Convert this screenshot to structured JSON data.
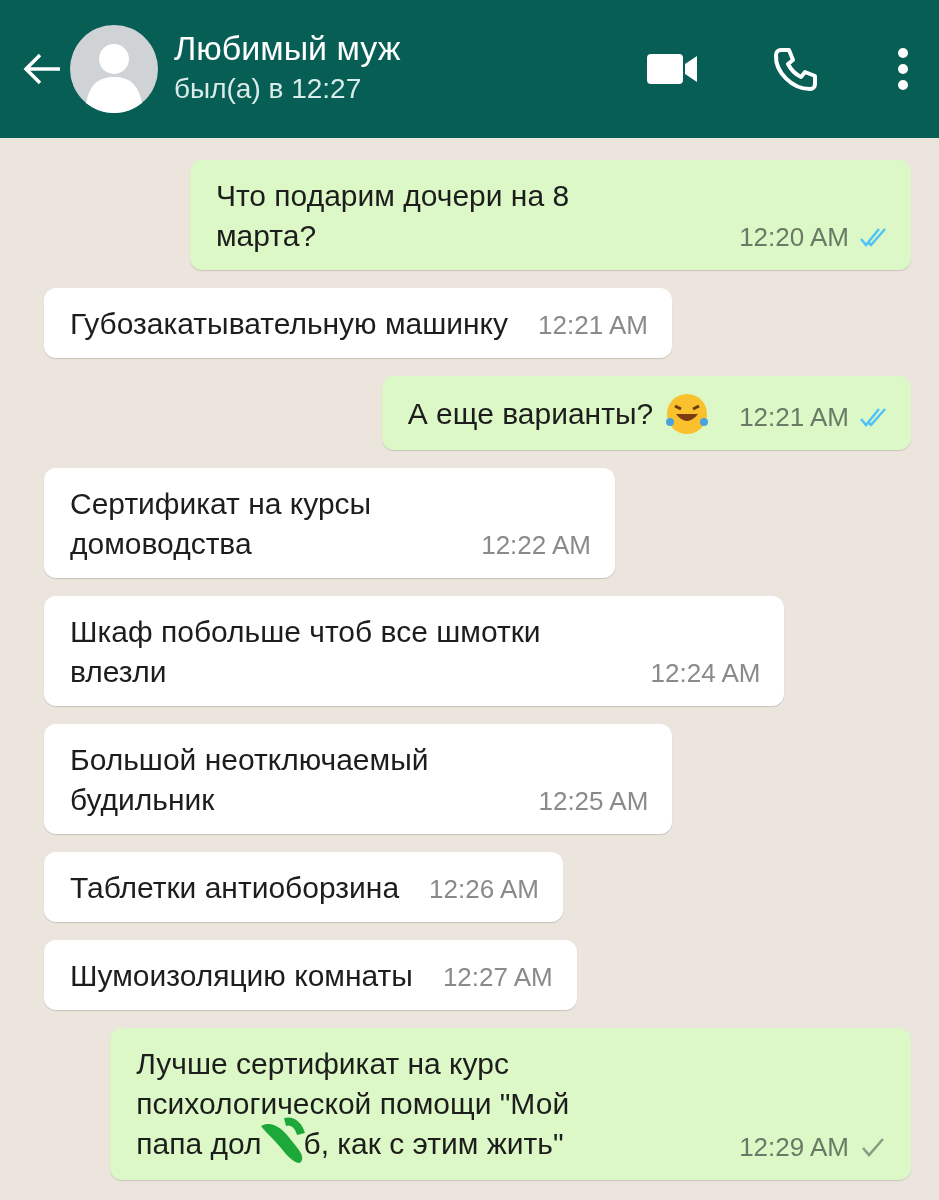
{
  "header": {
    "contact_name": "Любимый муж",
    "status": "был(а) в 12:27"
  },
  "messages": [
    {
      "outgoing": true,
      "lines": [
        "Что подарим дочери на 8",
        "марта?"
      ],
      "time": "12:20 AM",
      "read": true
    },
    {
      "outgoing": false,
      "lines": [
        "Губозакатывательную машинку"
      ],
      "time": "12:21 AM"
    },
    {
      "outgoing": true,
      "lines": [
        "А еще варианты?"
      ],
      "has_emoji": true,
      "time": "12:21 AM",
      "read": true
    },
    {
      "outgoing": false,
      "lines": [
        "Сертификат на курсы",
        "домоводства"
      ],
      "time": "12:22 AM"
    },
    {
      "outgoing": false,
      "lines": [
        "Шкаф побольше чтоб все шмотки",
        "влезли"
      ],
      "time": "12:24 AM"
    },
    {
      "outgoing": false,
      "lines": [
        "Большой неотключаемый",
        "будильник"
      ],
      "time": "12:25 AM"
    },
    {
      "outgoing": false,
      "lines": [
        "Таблетки антиоборзина"
      ],
      "time": "12:26 AM"
    },
    {
      "outgoing": false,
      "lines": [
        "Шумоизоляцию комнаты"
      ],
      "time": "12:27 AM"
    },
    {
      "outgoing": true,
      "lines": [
        "Лучше сертификат на курс",
        "психологической помощи \"Мой",
        "папа дол"
      ],
      "covered_tail": "б, как с этим жить\"",
      "time": "12:29 AM",
      "read": false
    }
  ]
}
